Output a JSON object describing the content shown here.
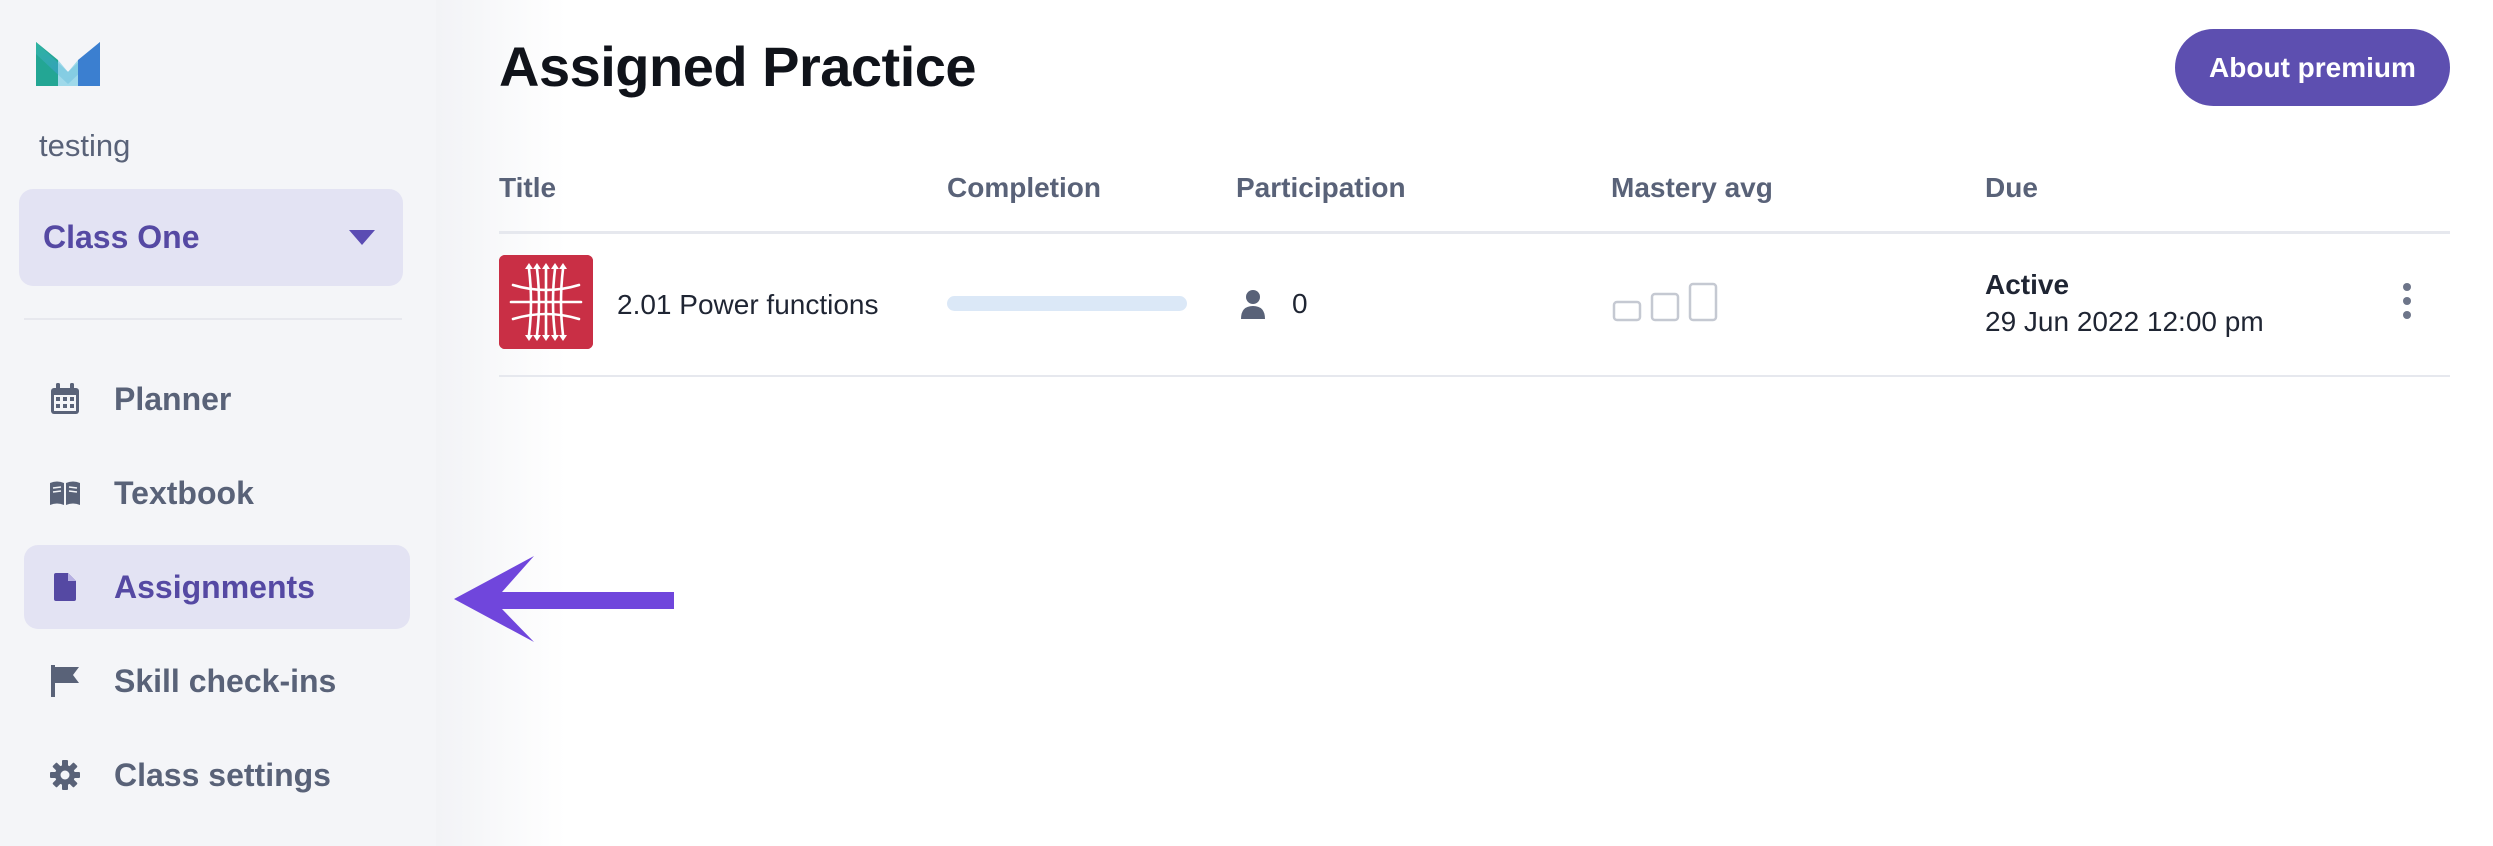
{
  "sidebar": {
    "logo_icon": "monogram-m-logo-icon",
    "org_name": "testing",
    "class_select": {
      "value": "Class One"
    },
    "nav_items": [
      {
        "label": "Planner",
        "icon": "calendar-icon",
        "active": false
      },
      {
        "label": "Textbook",
        "icon": "book-icon",
        "active": false
      },
      {
        "label": "Assignments",
        "icon": "document-icon",
        "active": true
      },
      {
        "label": "Skill check-ins",
        "icon": "flag-icon",
        "active": false
      },
      {
        "label": "Class settings",
        "icon": "gear-icon",
        "active": false
      }
    ]
  },
  "main": {
    "title": "Assigned Practice",
    "premium_button": "About premium",
    "table": {
      "columns": [
        "Title",
        "Completion",
        "Participation",
        "Mastery avg",
        "Due"
      ],
      "rows": [
        {
          "thumbnail_icon": "power-functions-thumbnail",
          "title": "2.01 Power functions",
          "completion": 0,
          "participation": "0",
          "mastery_icon": "mastery-bars-icon",
          "due_status": "Active",
          "due_date": "29 Jun 2022 12:00 pm"
        }
      ]
    }
  },
  "colors": {
    "accent": "#5d4fb0",
    "sidebar_bg": "#f4f5f8",
    "active_bg": "#e3e3f3",
    "arrow": "#7046dc",
    "thumbnail": "#c92f45"
  }
}
